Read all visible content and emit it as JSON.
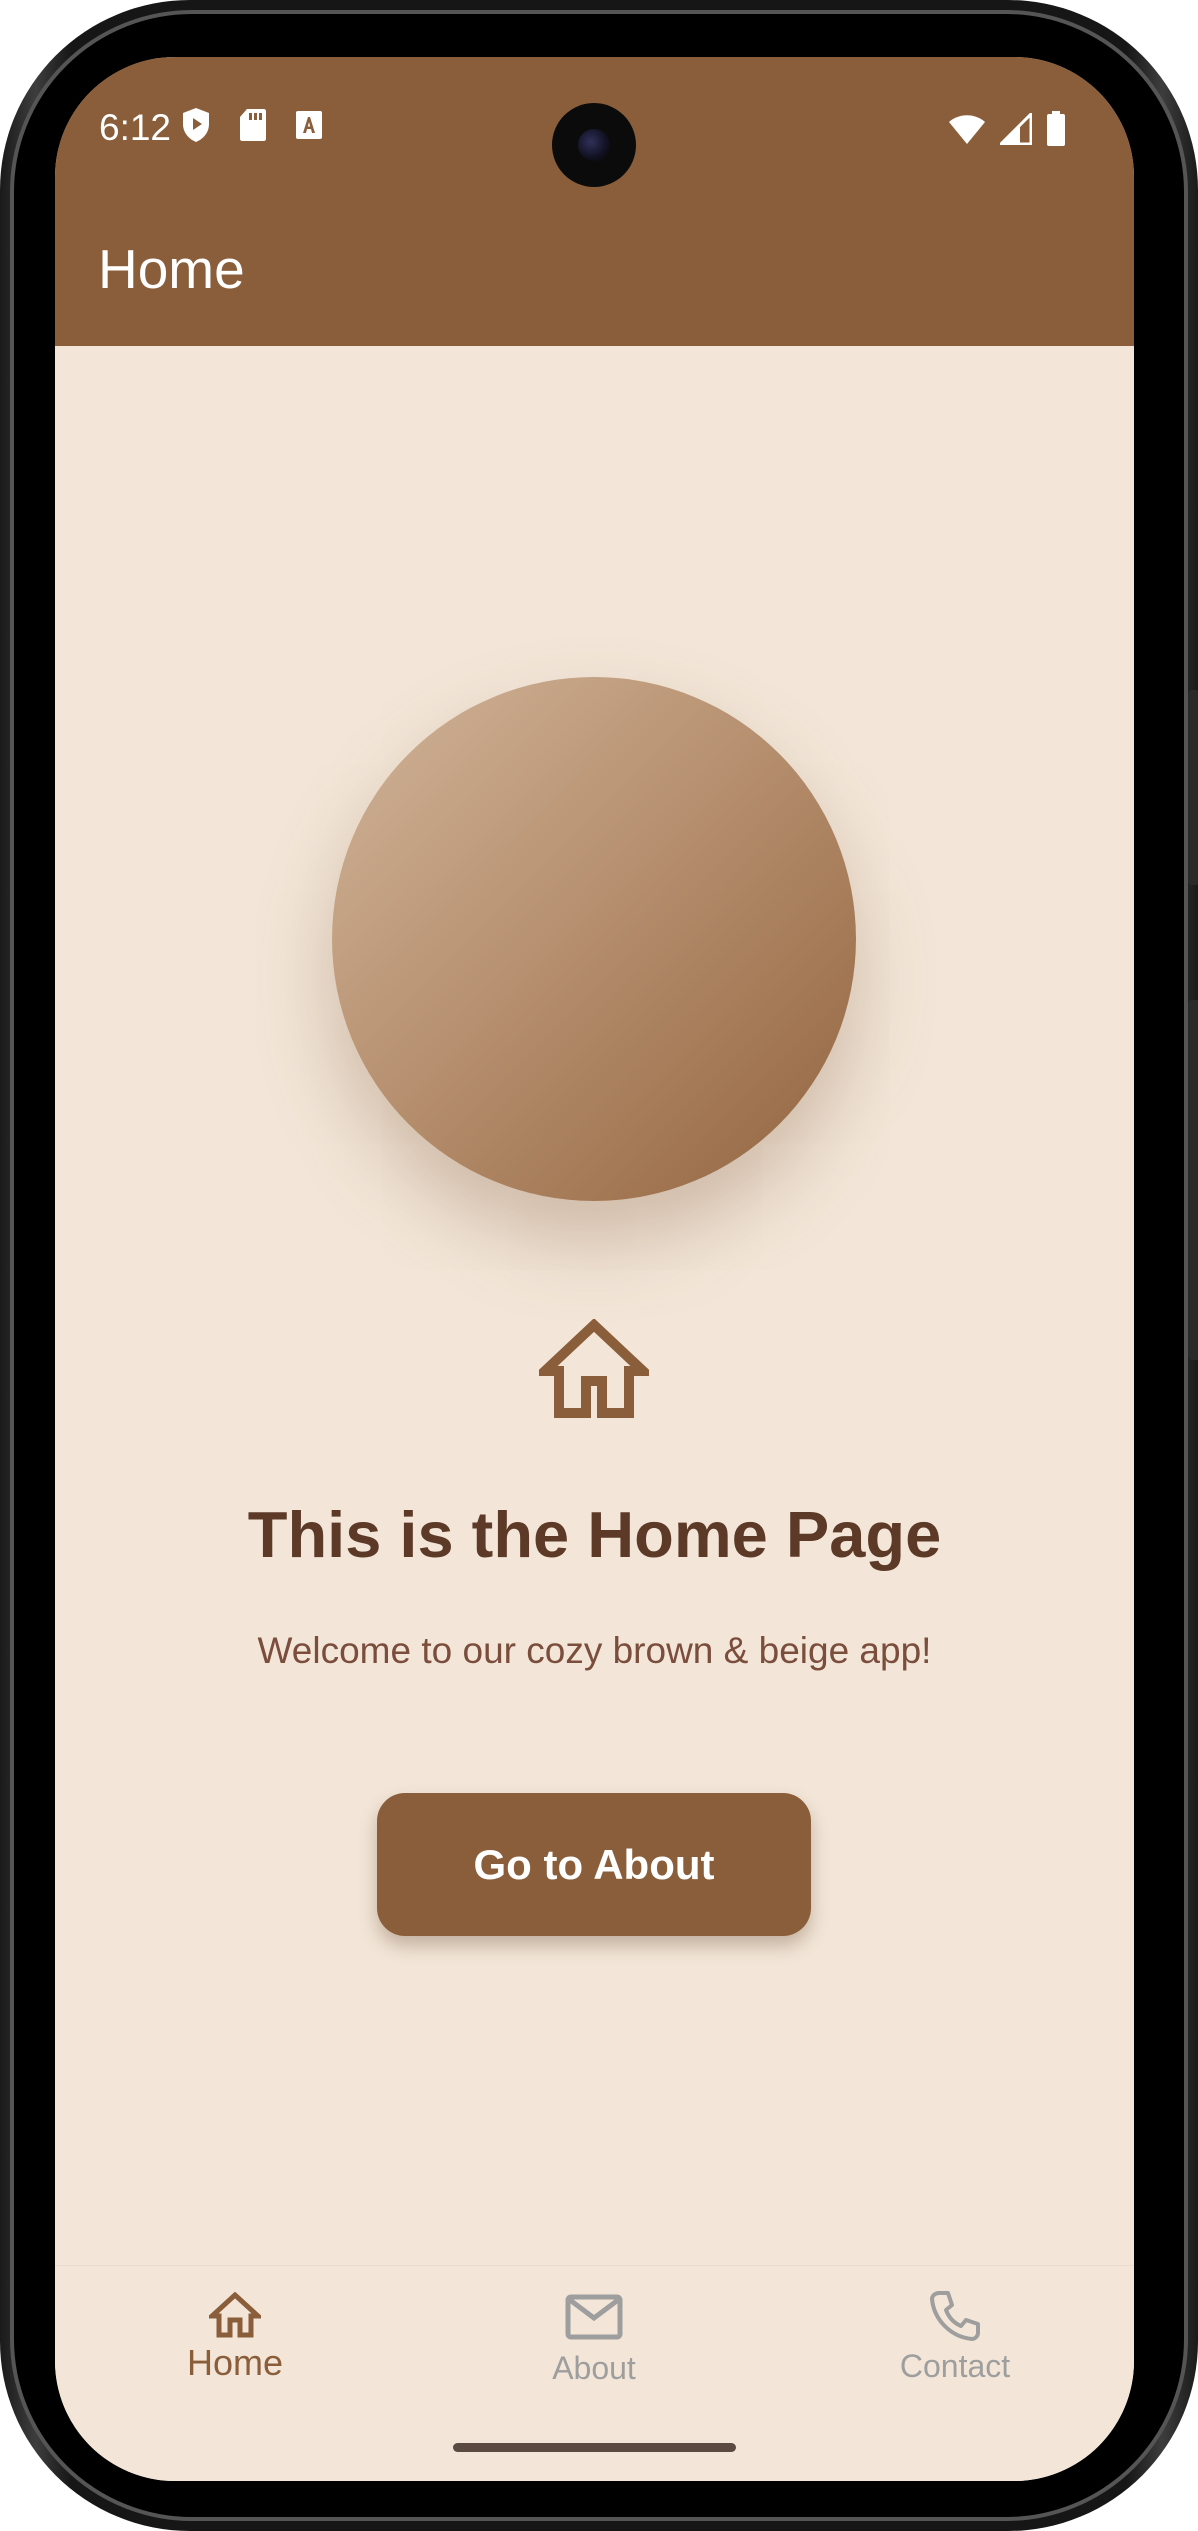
{
  "status_bar": {
    "time": "6:12"
  },
  "app_bar": {
    "title": "Home"
  },
  "main": {
    "heading": "This is the Home Page",
    "subtext": "Welcome to our cozy brown & beige app!",
    "cta_label": "Go to About",
    "hero_icon": "home-outline-icon"
  },
  "bottom_nav": {
    "items": [
      {
        "label": "Home",
        "icon": "home-icon",
        "active": true
      },
      {
        "label": "About",
        "icon": "mail-icon",
        "active": false
      },
      {
        "label": "Contact",
        "icon": "phone-icon",
        "active": false
      }
    ]
  },
  "colors": {
    "primary_brown": "#8b5e3b",
    "background_beige": "#f3e6d8",
    "heading_brown": "#5d3a28",
    "inactive_gray": "#9e9e9e"
  }
}
